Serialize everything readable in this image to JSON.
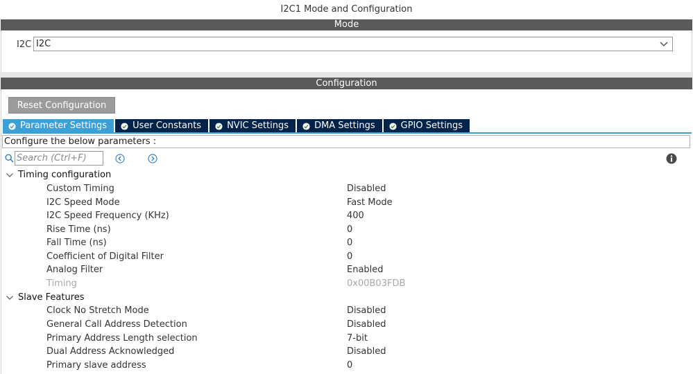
{
  "window": {
    "title": "I2C1 Mode and Configuration"
  },
  "mode": {
    "bar_label": "Mode",
    "field_label": "I2C",
    "selected": "I2C"
  },
  "configuration": {
    "bar_label": "Configuration",
    "reset_label": "Reset Configuration",
    "tabs": [
      {
        "label": "Parameter Settings",
        "active": true
      },
      {
        "label": "User Constants",
        "active": false
      },
      {
        "label": "NVIC Settings",
        "active": false
      },
      {
        "label": "DMA Settings",
        "active": false
      },
      {
        "label": "GPIO Settings",
        "active": false
      }
    ],
    "hint": "Configure the below parameters :",
    "search_placeholder": "Search (Ctrl+F)",
    "groups": [
      {
        "label": "Timing configuration",
        "params": [
          {
            "name": "Custom Timing",
            "value": "Disabled"
          },
          {
            "name": "I2C Speed Mode",
            "value": "Fast Mode"
          },
          {
            "name": "I2C Speed Frequency (KHz)",
            "value": "400"
          },
          {
            "name": "Rise Time (ns)",
            "value": "0"
          },
          {
            "name": "Fall Time (ns)",
            "value": "0"
          },
          {
            "name": "Coefficient of Digital Filter",
            "value": "0"
          },
          {
            "name": "Analog Filter",
            "value": "Enabled"
          },
          {
            "name": "Timing",
            "value": "0x00B03FDB",
            "disabled": true
          }
        ]
      },
      {
        "label": "Slave Features",
        "params": [
          {
            "name": "Clock No Stretch Mode",
            "value": "Disabled"
          },
          {
            "name": "General Call Address Detection",
            "value": "Disabled"
          },
          {
            "name": "Primary Address Length selection",
            "value": "7-bit"
          },
          {
            "name": "Dual Address Acknowledged",
            "value": "Disabled"
          },
          {
            "name": "Primary slave address",
            "value": "0"
          }
        ]
      }
    ]
  },
  "colors": {
    "section_bar": "#5a5a5a",
    "tab_active": "#3ba0d8",
    "tab_inactive": "#03234b",
    "reset_button": "#9b9b9b"
  },
  "icons": [
    "check-circle-icon",
    "search-icon",
    "arrow-left-circle-icon",
    "arrow-right-circle-icon",
    "info-icon",
    "chevron-down-icon"
  ]
}
